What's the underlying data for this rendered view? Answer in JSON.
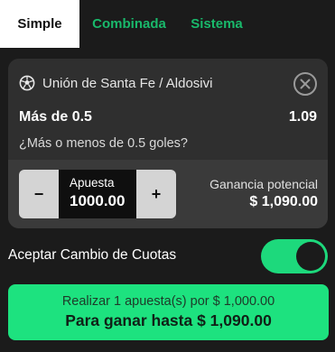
{
  "tabs": [
    {
      "label": "Simple",
      "active": true
    },
    {
      "label": "Combinada",
      "active": false
    },
    {
      "label": "Sistema",
      "active": false
    }
  ],
  "bet": {
    "sport_icon": "soccer-ball-icon",
    "match": "Unión de Santa Fe / Aldosivi",
    "selection": "Más de 0.5",
    "odds": "1.09",
    "market": "¿Más o menos de 0.5 goles?",
    "stake_label": "Apuesta",
    "stake_value": "1000.00",
    "decrement_label": "−",
    "increment_label": "+",
    "winnings_label": "Ganancia potencial",
    "winnings_value": "$ 1,090.00"
  },
  "accept_odds": {
    "label": "Aceptar Cambio de Cuotas",
    "enabled": true
  },
  "place_bet": {
    "line1": "Realizar 1 apuesta(s) por $ 1,000.00",
    "line2": "Para ganar hasta $ 1,090.00"
  },
  "colors": {
    "background": "#1b1b1b",
    "card": "#2f2f2f",
    "accent_green": "#1de27f",
    "tab_inactive_text": "#19b96b"
  }
}
